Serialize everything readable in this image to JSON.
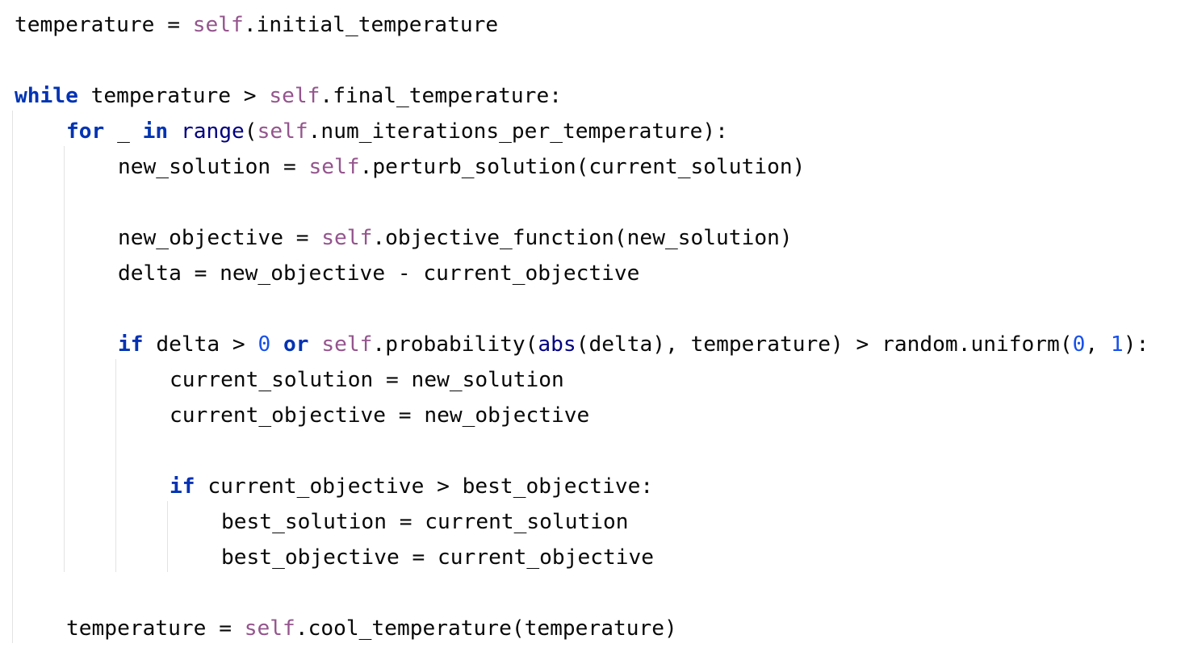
{
  "colors": {
    "background": "#ffffff",
    "text": "#080808",
    "keyword": "#0033b3",
    "self": "#94558d",
    "builtin": "#000080",
    "number": "#1750eb",
    "indent_guide": "#e3e3e3"
  },
  "code": {
    "lines": [
      {
        "indent": 0,
        "tokens": [
          {
            "t": "temperature = ",
            "k": "plain"
          },
          {
            "t": "self",
            "k": "self"
          },
          {
            "t": ".initial_temperature",
            "k": "plain"
          }
        ]
      },
      {
        "indent": 0,
        "tokens": []
      },
      {
        "indent": 0,
        "tokens": [
          {
            "t": "while",
            "k": "keyword"
          },
          {
            "t": " temperature > ",
            "k": "plain"
          },
          {
            "t": "self",
            "k": "self"
          },
          {
            "t": ".final_temperature:",
            "k": "plain"
          }
        ]
      },
      {
        "indent": 1,
        "tokens": [
          {
            "t": "for",
            "k": "keyword"
          },
          {
            "t": " _ ",
            "k": "plain"
          },
          {
            "t": "in",
            "k": "keyword"
          },
          {
            "t": " ",
            "k": "plain"
          },
          {
            "t": "range",
            "k": "builtin"
          },
          {
            "t": "(",
            "k": "plain"
          },
          {
            "t": "self",
            "k": "self"
          },
          {
            "t": ".num_iterations_per_temperature):",
            "k": "plain"
          }
        ]
      },
      {
        "indent": 2,
        "tokens": [
          {
            "t": "new_solution = ",
            "k": "plain"
          },
          {
            "t": "self",
            "k": "self"
          },
          {
            "t": ".perturb_solution(current_solution)",
            "k": "plain"
          }
        ]
      },
      {
        "indent": 2,
        "tokens": []
      },
      {
        "indent": 2,
        "tokens": [
          {
            "t": "new_objective = ",
            "k": "plain"
          },
          {
            "t": "self",
            "k": "self"
          },
          {
            "t": ".objective_function(new_solution)",
            "k": "plain"
          }
        ]
      },
      {
        "indent": 2,
        "tokens": [
          {
            "t": "delta = new_objective - current_objective",
            "k": "plain"
          }
        ]
      },
      {
        "indent": 2,
        "tokens": []
      },
      {
        "indent": 2,
        "tokens": [
          {
            "t": "if",
            "k": "keyword"
          },
          {
            "t": " delta > ",
            "k": "plain"
          },
          {
            "t": "0",
            "k": "number"
          },
          {
            "t": " ",
            "k": "plain"
          },
          {
            "t": "or",
            "k": "keyword"
          },
          {
            "t": " ",
            "k": "plain"
          },
          {
            "t": "self",
            "k": "self"
          },
          {
            "t": ".probability(",
            "k": "plain"
          },
          {
            "t": "abs",
            "k": "builtin"
          },
          {
            "t": "(delta), temperature) > random.uniform(",
            "k": "plain"
          },
          {
            "t": "0",
            "k": "number"
          },
          {
            "t": ", ",
            "k": "plain"
          },
          {
            "t": "1",
            "k": "number"
          },
          {
            "t": "):",
            "k": "plain"
          }
        ]
      },
      {
        "indent": 3,
        "tokens": [
          {
            "t": "current_solution = new_solution",
            "k": "plain"
          }
        ]
      },
      {
        "indent": 3,
        "tokens": [
          {
            "t": "current_objective = new_objective",
            "k": "plain"
          }
        ]
      },
      {
        "indent": 3,
        "tokens": []
      },
      {
        "indent": 3,
        "tokens": [
          {
            "t": "if",
            "k": "keyword"
          },
          {
            "t": " current_objective > best_objective:",
            "k": "plain"
          }
        ]
      },
      {
        "indent": 4,
        "tokens": [
          {
            "t": "best_solution = current_solution",
            "k": "plain"
          }
        ]
      },
      {
        "indent": 4,
        "tokens": [
          {
            "t": "best_objective = current_objective",
            "k": "plain"
          }
        ]
      },
      {
        "indent": 1,
        "tokens": []
      },
      {
        "indent": 1,
        "tokens": [
          {
            "t": "temperature = ",
            "k": "plain"
          },
          {
            "t": "self",
            "k": "self"
          },
          {
            "t": ".cool_temperature(temperature)",
            "k": "plain"
          }
        ]
      }
    ]
  }
}
